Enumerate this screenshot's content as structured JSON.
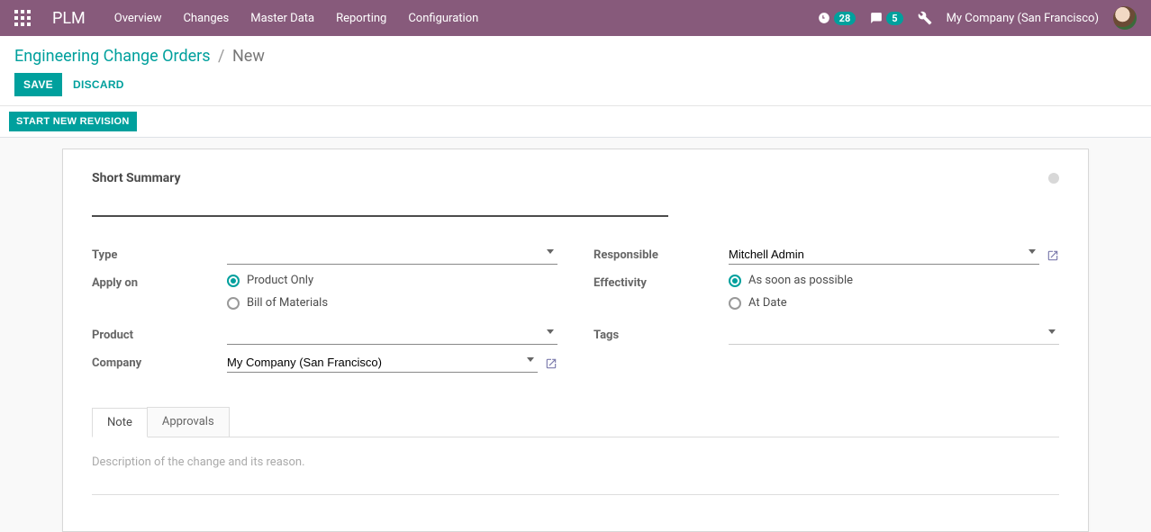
{
  "nav": {
    "brand": "PLM",
    "menu": [
      "Overview",
      "Changes",
      "Master Data",
      "Reporting",
      "Configuration"
    ],
    "clock_badge": "28",
    "chat_badge": "5",
    "company": "My Company (San Francisco)"
  },
  "breadcrumb": {
    "parent": "Engineering Change Orders",
    "current": "New"
  },
  "buttons": {
    "save": "SAVE",
    "discard": "DISCARD",
    "start_revision": "START NEW REVISION"
  },
  "form": {
    "summary_label": "Short Summary",
    "summary_value": "",
    "left": {
      "type_label": "Type",
      "type_value": "",
      "apply_on_label": "Apply on",
      "apply_on_options": [
        {
          "label": "Product Only",
          "checked": true
        },
        {
          "label": "Bill of Materials",
          "checked": false
        }
      ],
      "product_label": "Product",
      "product_value": "",
      "company_label": "Company",
      "company_value": "My Company (San Francisco)"
    },
    "right": {
      "responsible_label": "Responsible",
      "responsible_value": "Mitchell Admin",
      "effectivity_label": "Effectivity",
      "effectivity_options": [
        {
          "label": "As soon as possible",
          "checked": true
        },
        {
          "label": "At Date",
          "checked": false
        }
      ],
      "tags_label": "Tags",
      "tags_value": ""
    }
  },
  "tabs": {
    "items": [
      "Note",
      "Approvals"
    ],
    "note_placeholder": "Description of the change and its reason."
  }
}
